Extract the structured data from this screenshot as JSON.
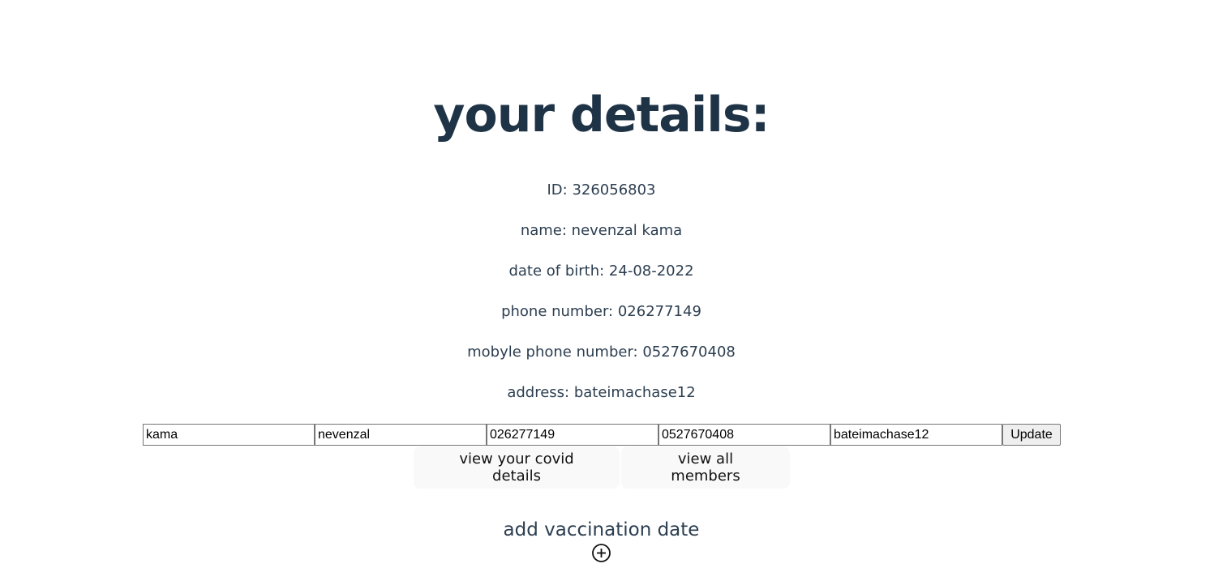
{
  "header": {
    "title": "your details:"
  },
  "details": [
    {
      "label": "ID: ",
      "value": "326056803"
    },
    {
      "label": "name: ",
      "value": "nevenzal kama"
    },
    {
      "label": "date of birth: ",
      "value": "24-08-2022"
    },
    {
      "label": "phone number: ",
      "value": "026277149"
    },
    {
      "label": "mobyle phone number: ",
      "value": "0527670408"
    },
    {
      "label": "address: ",
      "value": "bateimachase12"
    }
  ],
  "edit_form": {
    "last_name_value": "kama",
    "first_name_value": "nevenzal",
    "phone_value": "026277149",
    "mobile_value": "0527670408",
    "address_value": "bateimachase12",
    "update_label": "Update"
  },
  "nav": {
    "covid_label": "view your covid details",
    "members_label": "view all members"
  },
  "vaccination": {
    "title": "add vaccination date",
    "icon": "plus-circle-icon"
  },
  "colors": {
    "heading": "#1f3347",
    "text": "#2c3e50",
    "nav_button_bg": "#f9f9f9",
    "update_button_bg": "#efefef"
  }
}
